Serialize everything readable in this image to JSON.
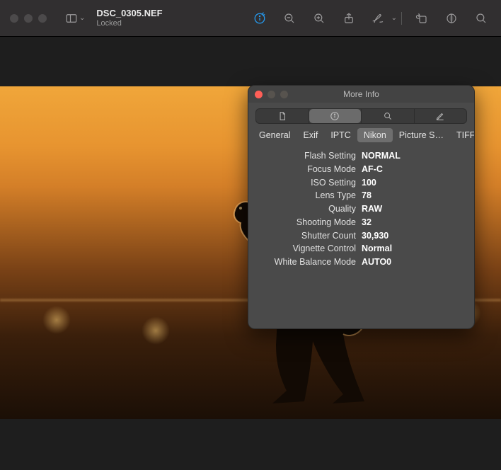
{
  "toolbar": {
    "filename": "DSC_0305.NEF",
    "status": "Locked"
  },
  "panel": {
    "title": "More Info",
    "segmented": [
      "document",
      "info",
      "search",
      "edit"
    ],
    "segmented_active_index": 1,
    "tabs": [
      "General",
      "Exif",
      "IPTC",
      "Nikon",
      "Picture S…",
      "TIFF"
    ],
    "active_tab_index": 3,
    "rows": [
      {
        "k": "Flash Setting",
        "v": "NORMAL"
      },
      {
        "k": "Focus Mode",
        "v": "AF-C"
      },
      {
        "k": "ISO Setting",
        "v": "100"
      },
      {
        "k": "Lens Type",
        "v": "78"
      },
      {
        "k": "Quality",
        "v": "RAW"
      },
      {
        "k": "Shooting Mode",
        "v": "32"
      },
      {
        "k": "Shutter Count",
        "v": "30,930"
      },
      {
        "k": "Vignette Control",
        "v": "Normal"
      },
      {
        "k": "White Balance Mode",
        "v": "AUTO0"
      }
    ]
  }
}
